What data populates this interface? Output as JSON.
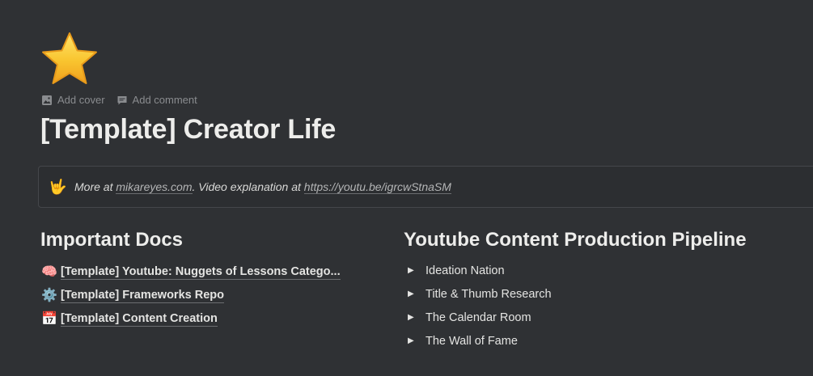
{
  "page": {
    "icon": "star-emoji",
    "title": "[Template] Creator Life"
  },
  "actions": {
    "add_cover": "Add cover",
    "add_comment": "Add comment"
  },
  "callout": {
    "icon": "🤟",
    "prefix": "More at ",
    "link1": "mikareyes.com",
    "middle": ". Video explanation at ",
    "link2": "https://youtu.be/igrcwStnaSM"
  },
  "docs": {
    "heading": "Important Docs",
    "items": [
      {
        "icon": "🧠",
        "label": "[Template] Youtube: Nuggets of Lessons Catego..."
      },
      {
        "icon": "⚙️",
        "label": "[Template] Frameworks Repo"
      },
      {
        "icon": "📅",
        "label": "[Template] Content Creation"
      }
    ]
  },
  "pipeline": {
    "heading": "Youtube Content Production Pipeline",
    "toggle_icon": "▶",
    "items": [
      {
        "label": "Ideation Nation"
      },
      {
        "label": "Title & Thumb Research"
      },
      {
        "label": "The Calendar Room"
      },
      {
        "label": "The Wall of Fame"
      }
    ]
  },
  "colors": {
    "background": "#2f3134",
    "text": "#e8e8e6",
    "muted": "#8a8c8f",
    "star": "#f6c533"
  }
}
